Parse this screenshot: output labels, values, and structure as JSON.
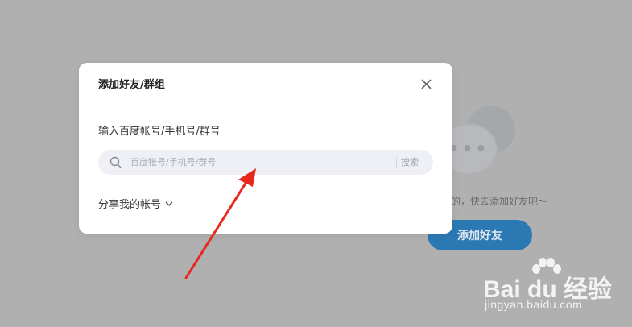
{
  "background": {
    "empty_hint": "的，快去添加好友吧～",
    "add_friend_button": "添加好友",
    "bubble_dots": "•••"
  },
  "dialog": {
    "title": "添加好友/群组",
    "field_label": "输入百度帐号/手机号/群号",
    "search": {
      "placeholder": "百度帐号/手机号/群号",
      "value": "",
      "button_label": "搜索"
    },
    "share_label": "分享我的帐号"
  },
  "watermark": {
    "brand": "Bai du 经验",
    "url": "jingyan.baidu.com"
  },
  "colors": {
    "overlay": "#b0b0b0",
    "primary_button": "#2b79b3",
    "arrow": "#e8271e",
    "search_bg": "#eff0f5"
  },
  "icons": {
    "close": "close-icon",
    "search": "search-icon",
    "chevron": "chevron-down-icon",
    "paw": "paw-icon",
    "chat": "chat-bubble-icon"
  }
}
